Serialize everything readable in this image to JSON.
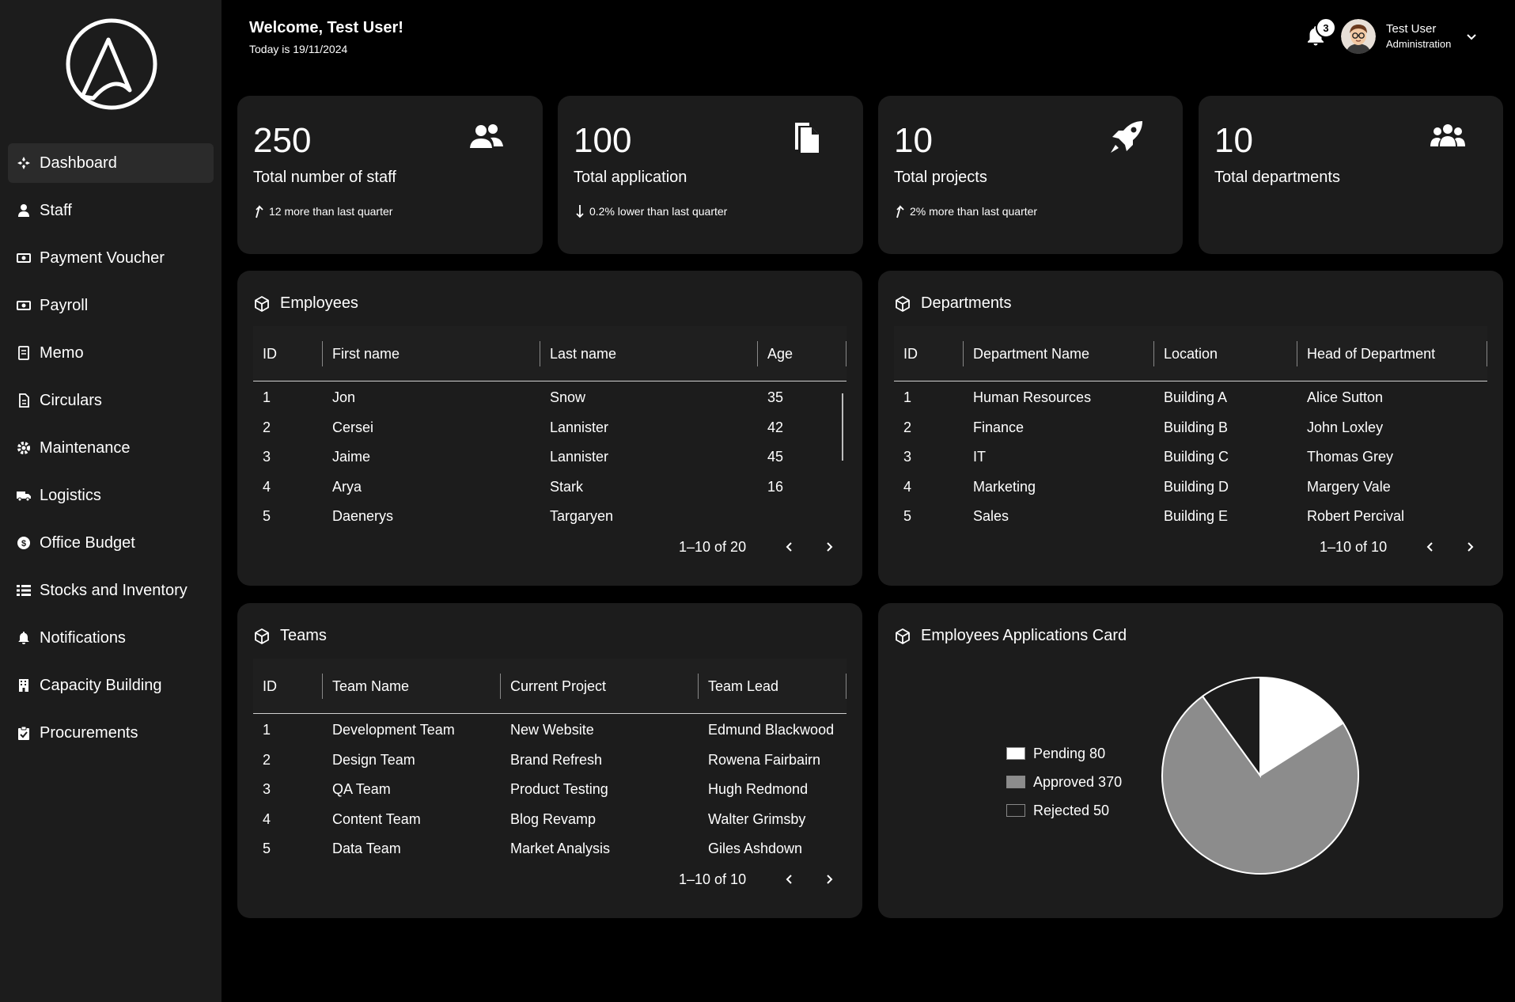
{
  "sidebar": {
    "items": [
      {
        "label": "Dashboard",
        "icon": "dashboard-icon"
      },
      {
        "label": "Staff",
        "icon": "person-icon"
      },
      {
        "label": "Payment Voucher",
        "icon": "money-icon"
      },
      {
        "label": "Payroll",
        "icon": "money-icon"
      },
      {
        "label": "Memo",
        "icon": "memo-icon"
      },
      {
        "label": "Circulars",
        "icon": "document-icon"
      },
      {
        "label": "Maintenance",
        "icon": "gear-icon"
      },
      {
        "label": "Logistics",
        "icon": "truck-icon"
      },
      {
        "label": "Office Budget",
        "icon": "coin-icon"
      },
      {
        "label": "Stocks and Inventory",
        "icon": "list-icon"
      },
      {
        "label": "Notifications",
        "icon": "bell-icon"
      },
      {
        "label": "Capacity Building",
        "icon": "building-icon"
      },
      {
        "label": "Procurements",
        "icon": "clipboard-check-icon"
      }
    ],
    "active_index": 0
  },
  "header": {
    "welcome": "Welcome, Test User!",
    "today": "Today is 19/11/2024",
    "notification_count": "3",
    "user_name": "Test User",
    "user_role": "Administration"
  },
  "stats": [
    {
      "value": "250",
      "label": "Total number of staff",
      "trend": "12 more than last quarter",
      "direction": "up",
      "icon": "people-icon"
    },
    {
      "value": "100",
      "label": "Total application",
      "trend": "0.2% lower than last quarter",
      "direction": "down",
      "icon": "files-icon"
    },
    {
      "value": "10",
      "label": "Total projects",
      "trend": "2% more than last quarter",
      "direction": "up",
      "icon": "rocket-icon"
    },
    {
      "value": "10",
      "label": "Total departments",
      "trend": "",
      "direction": "",
      "icon": "group-icon"
    }
  ],
  "employees": {
    "title": "Employees",
    "columns": [
      "ID",
      "First name",
      "Last name",
      "Age"
    ],
    "rows": [
      [
        "1",
        "Jon",
        "Snow",
        "35"
      ],
      [
        "2",
        "Cersei",
        "Lannister",
        "42"
      ],
      [
        "3",
        "Jaime",
        "Lannister",
        "45"
      ],
      [
        "4",
        "Arya",
        "Stark",
        "16"
      ],
      [
        "5",
        "Daenerys",
        "Targaryen",
        ""
      ]
    ],
    "pagination": "1–10 of 20"
  },
  "departments": {
    "title": "Departments",
    "columns": [
      "ID",
      "Department Name",
      "Location",
      "Head of Department"
    ],
    "rows": [
      [
        "1",
        "Human Resources",
        "Building A",
        "Alice Sutton"
      ],
      [
        "2",
        "Finance",
        "Building B",
        "John Loxley"
      ],
      [
        "3",
        "IT",
        "Building C",
        "Thomas Grey"
      ],
      [
        "4",
        "Marketing",
        "Building D",
        "Margery Vale"
      ],
      [
        "5",
        "Sales",
        "Building E",
        "Robert Percival"
      ]
    ],
    "pagination": "1–10 of 10"
  },
  "teams": {
    "title": "Teams",
    "columns": [
      "ID",
      "Team Name",
      "Current Project",
      "Team Lead"
    ],
    "rows": [
      [
        "1",
        "Development Team",
        "New Website",
        "Edmund Blackwood"
      ],
      [
        "2",
        "Design Team",
        "Brand Refresh",
        "Rowena Fairbairn"
      ],
      [
        "3",
        "QA Team",
        "Product Testing",
        "Hugh Redmond"
      ],
      [
        "4",
        "Content Team",
        "Blog Revamp",
        "Walter Grimsby"
      ],
      [
        "5",
        "Data Team",
        "Market Analysis",
        "Giles Ashdown"
      ]
    ],
    "pagination": "1–10 of 10"
  },
  "applications_card": {
    "title": "Employees Applications Card"
  },
  "chart_data": {
    "type": "pie",
    "title": "",
    "categories": [
      "Pending",
      "Approved",
      "Rejected"
    ],
    "values": [
      80,
      370,
      50
    ],
    "legend_labels": [
      "Pending 80",
      "Approved 370",
      "Rejected 50"
    ],
    "colors": [
      "#ffffff",
      "#8c8c8c",
      "#1c1c1c"
    ],
    "legend_position": "left"
  },
  "colors": {
    "background": "#000000",
    "sidebar": "#1c1c1c",
    "card": "#1c1c1c",
    "text": "#ffffff"
  }
}
